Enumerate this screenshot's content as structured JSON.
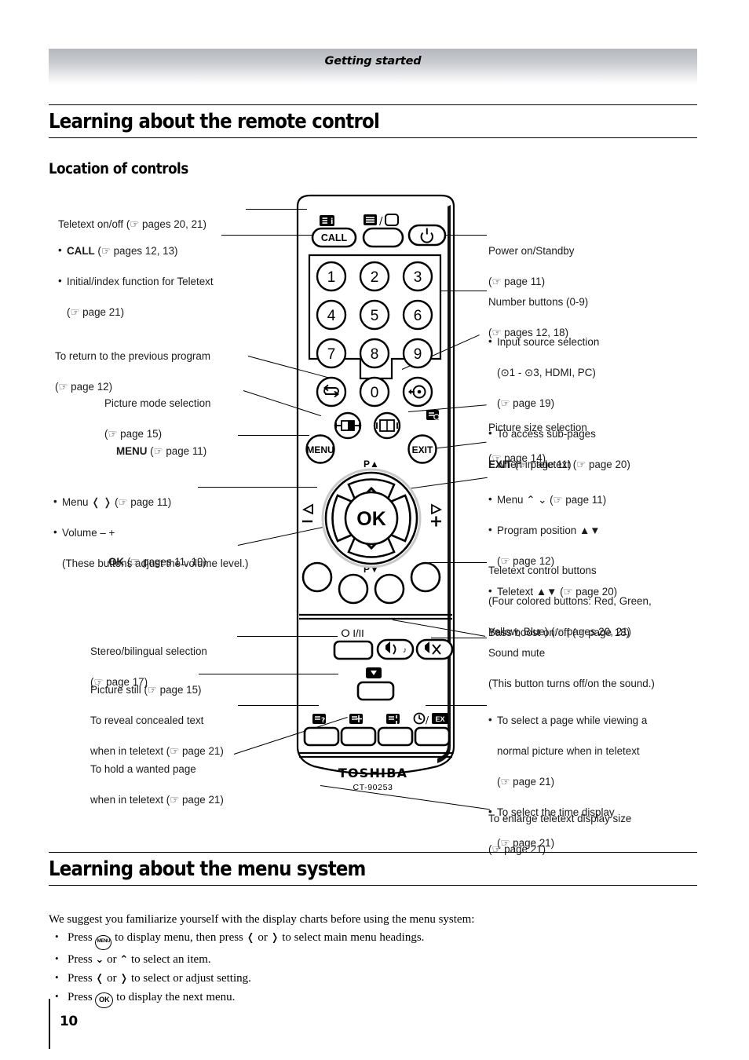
{
  "header": {
    "running_title": "Getting started"
  },
  "sections": {
    "remote_heading": "Learning about the remote control",
    "location_heading": "Location of controls",
    "menu_heading": "Learning about the menu system"
  },
  "hand_glyph": "☞",
  "left_notes": {
    "teletext_onoff": {
      "l1": "Teletext on/off (☞ pages 20, 21)"
    },
    "call": {
      "l1": "CALL",
      "l1_rest": " (☞ pages 12, 13)",
      "l2": "Initial/index function for Teletext",
      "l3": "(☞ page 21)"
    },
    "previous_program": {
      "l1": "To return to the previous program",
      "l2": "(☞ page 12)"
    },
    "picture_mode": {
      "l1": "Picture mode selection",
      "l2": "(☞ page 15)"
    },
    "menu": {
      "l1": "MENU",
      "l1_rest": " (☞ page 11)"
    },
    "menu_lr": {
      "l1": "Menu ❬ ❭ (☞ page 11)",
      "l2": "Volume – +",
      "l3": "(These buttons adjust the volume level.)"
    },
    "ok": {
      "l1": "OK",
      "l1_rest": " (☞ pages 11, 19)"
    },
    "stereo": {
      "l1": "Stereo/bilingual selection",
      "l2": "(☞ page 17)"
    },
    "picture_still": {
      "l1": "Picture still (☞ page 15)"
    },
    "reveal_text": {
      "l1": "To reveal concealed text",
      "l2": "when in teletext (☞ page 21)"
    },
    "hold_page": {
      "l1": "To hold a wanted page",
      "l2": "when in teletext (☞ page 21)"
    }
  },
  "right_notes": {
    "power": {
      "l1": "Power on/Standby",
      "l2": "(☞ page 11)"
    },
    "number_buttons": {
      "l1": "Number buttons (0-9)",
      "l2": "(☞ pages 12, 18)"
    },
    "input_source": {
      "l1": "Input source selection",
      "l2": "(⊙1 - ⊙3, HDMI, PC)",
      "l3": "(☞ page 19)",
      "l4": "To access sub-pages",
      "l5": "when in teletext (☞ page 20)"
    },
    "picture_size": {
      "l1": "Picture size selection",
      "l2": "(☞ page 14)"
    },
    "exit": {
      "l1": "EXIT",
      "l1_rest": " (☞ page 11)"
    },
    "menu_updown": {
      "l1": "Menu ⌃ ⌄ (☞ page 11)",
      "l2": "Program position ▲▼",
      "l3": "(☞ page 12)",
      "l4": "Teletext ▲▼ (☞ page 20)"
    },
    "teletext_controls": {
      "l1": "Teletext control buttons",
      "l2": "(Four colored buttons: Red, Green,",
      "l3": "Yellow, Blue) (☞ pages 20, 21)"
    },
    "bass_boost": {
      "l1": "Bass boost on/off (☞ page 18)"
    },
    "sound_mute": {
      "l1": "Sound mute",
      "l2": "(This button turns off/on the sound.)"
    },
    "select_page": {
      "l1": "To select a page while viewing a",
      "l2": "normal picture when in teletext",
      "l3": "(☞ page 21)",
      "l4": "To select the time display",
      "l5": "(☞ page 21)"
    },
    "enlarge": {
      "l1": "To enlarge teletext display size",
      "l2": "(☞ page 21)"
    }
  },
  "remote": {
    "call_label": "CALL",
    "index_icon": "teletext-index-icon",
    "teletext_icon": "teletext-toggle-icon",
    "power_icon": "power-icon",
    "numbers": [
      "1",
      "2",
      "3",
      "4",
      "5",
      "6",
      "7",
      "8",
      "9",
      "0"
    ],
    "return_icon": "return-arrow-icon",
    "input_icon": "input-source-icon",
    "subpage_icon": "subpage-icon",
    "picture_mode_icon": "picture-mode-icon",
    "picture_size_icon": "picture-size-icon",
    "menu_label": "MENU",
    "exit_label": "EXIT",
    "ok_label": "OK",
    "p_up_label": "P▲",
    "p_down_label": "P▼",
    "vol_down_icon": "volume-down-icon",
    "vol_up_icon": "volume-up-icon",
    "stereo_label": "ⵔ I/II",
    "bass_icon": "bass-boost-icon",
    "mute_icon": "mute-icon",
    "still_icon": "picture-still-icon",
    "reveal_icon": "teletext-reveal-icon",
    "hold_icon": "teletext-hold-icon",
    "size_icon": "teletext-size-icon",
    "time_icon": "teletext-time-icon",
    "brand": "TOSHIBA",
    "model": "CT-90253"
  },
  "menu_system": {
    "intro": "We suggest you familiarize yourself with the display charts before using the menu system:",
    "step1_a": "Press",
    "step1_key": "MENU",
    "step1_b": "to display menu, then press",
    "step1_arrow1": "❬",
    "step1_or": "or",
    "step1_arrow2": "❭",
    "step1_c": "to select main menu headings.",
    "step2_a": "Press",
    "step2_arrow1": "⌄",
    "step2_or": "or",
    "step2_arrow2": "⌃",
    "step2_b": "to select an item.",
    "step3_a": "Press",
    "step3_arrow1": "❬",
    "step3_or": "or",
    "step3_arrow2": "❭",
    "step3_b": "to select or adjust setting.",
    "step4_a": "Press",
    "step4_key": "OK",
    "step4_b": "to display the next menu."
  },
  "footer": {
    "page_number": "10"
  }
}
